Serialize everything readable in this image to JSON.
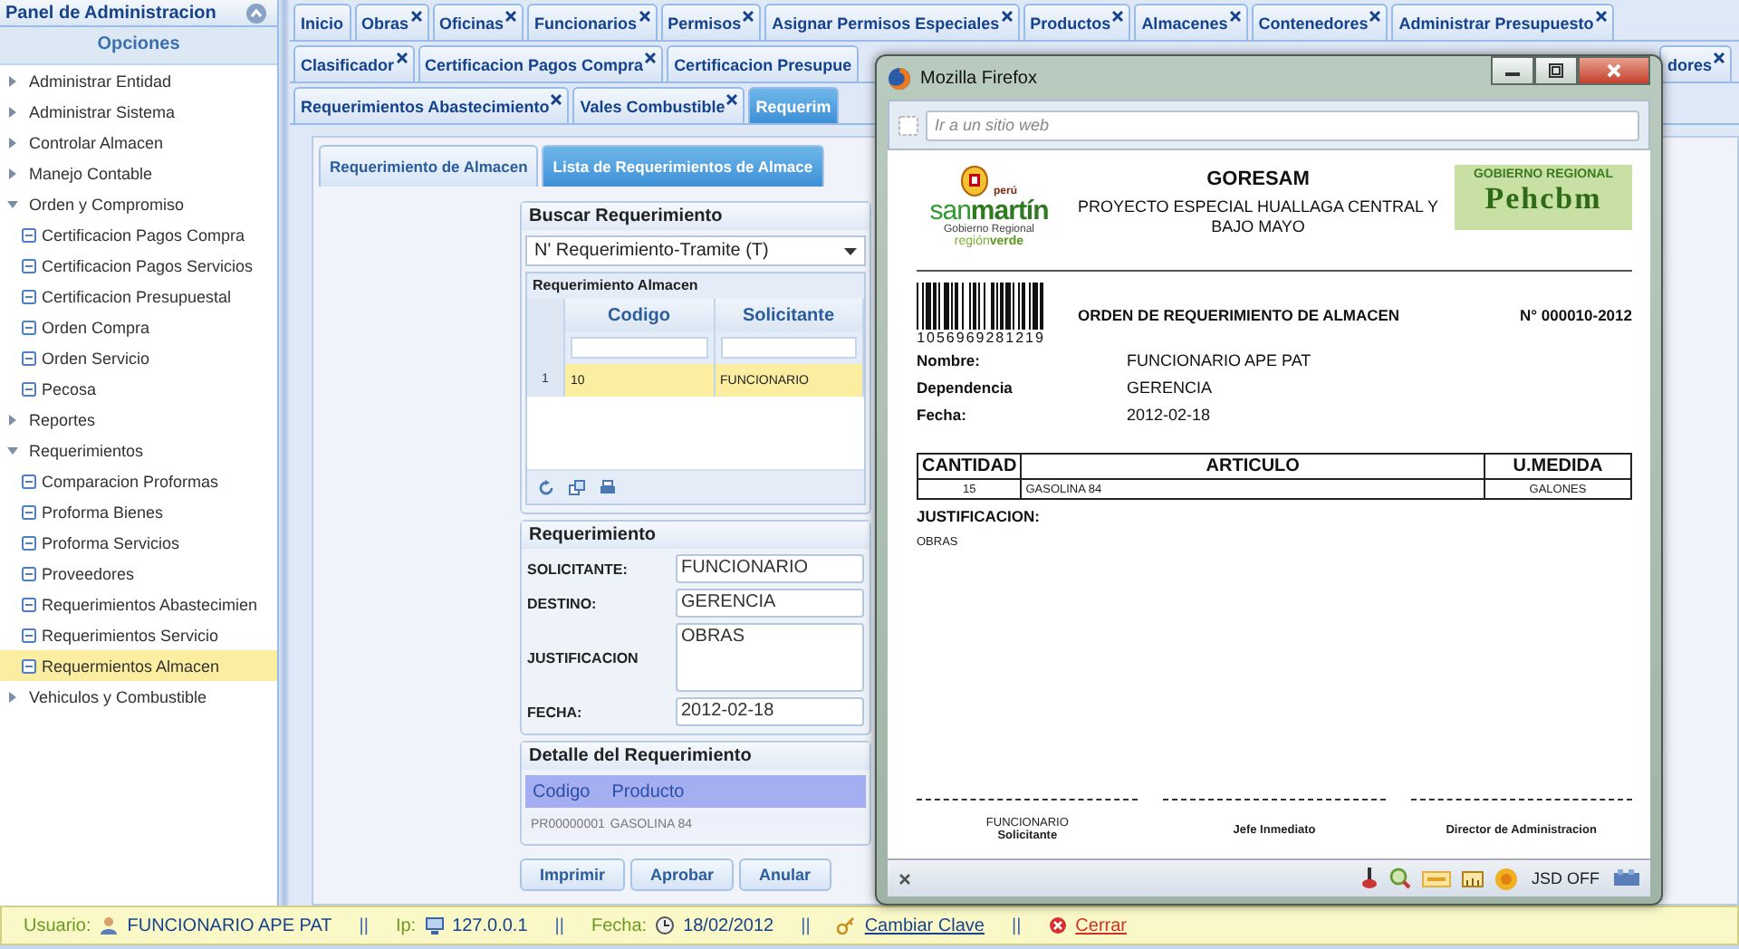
{
  "sidebar": {
    "title": "Panel de Administracion",
    "subtitle": "Opciones",
    "items": [
      {
        "label": "Administrar Entidad",
        "expanded": false
      },
      {
        "label": "Administrar Sistema",
        "expanded": false
      },
      {
        "label": "Controlar Almacen",
        "expanded": false
      },
      {
        "label": "Manejo Contable",
        "expanded": false
      },
      {
        "label": "Orden y Compromiso",
        "expanded": true,
        "children": [
          {
            "label": "Certificacion Pagos Compra",
            "selected": false
          },
          {
            "label": "Certificacion Pagos Servicios",
            "selected": false
          },
          {
            "label": "Certificacion Presupuestal",
            "selected": false
          },
          {
            "label": "Orden Compra",
            "selected": false
          },
          {
            "label": "Orden Servicio",
            "selected": false
          },
          {
            "label": "Pecosa",
            "selected": false
          }
        ]
      },
      {
        "label": "Reportes",
        "expanded": false
      },
      {
        "label": "Requerimientos",
        "expanded": true,
        "children": [
          {
            "label": "Comparacion Proformas",
            "selected": false
          },
          {
            "label": "Proforma Bienes",
            "selected": false
          },
          {
            "label": "Proforma Servicios",
            "selected": false
          },
          {
            "label": "Proveedores",
            "selected": false
          },
          {
            "label": "Requerimientos Abastecimien",
            "selected": false
          },
          {
            "label": "Requerimientos Servicio",
            "selected": false
          },
          {
            "label": "Requermientos Almacen",
            "selected": true
          }
        ]
      },
      {
        "label": "Vehiculos y Combustible",
        "expanded": false
      }
    ]
  },
  "tab_rows": [
    {
      "tabs": [
        {
          "label": "Inicio",
          "closable": false,
          "selected": false
        },
        {
          "label": "Obras",
          "closable": true,
          "selected": false
        },
        {
          "label": "Oficinas",
          "closable": true,
          "selected": false
        },
        {
          "label": "Funcionarios",
          "closable": true,
          "selected": false
        },
        {
          "label": "Permisos",
          "closable": true,
          "selected": false
        },
        {
          "label": "Asignar Permisos Especiales",
          "closable": true,
          "selected": false
        },
        {
          "label": "Productos",
          "closable": true,
          "selected": false
        },
        {
          "label": "Almacenes",
          "closable": true,
          "selected": false
        },
        {
          "label": "Contenedores",
          "closable": true,
          "selected": false
        },
        {
          "label": "Administrar Presupuesto",
          "closable": true,
          "selected": false
        }
      ]
    },
    {
      "tabs": [
        {
          "label": "Clasificador",
          "closable": true,
          "selected": false
        },
        {
          "label": "Certificacion Pagos Compra",
          "closable": true,
          "selected": false
        },
        {
          "label": "Certificacion Presupue",
          "closable": false,
          "selected": false
        },
        {
          "label": "dores",
          "closable": true,
          "selected": false,
          "kind": "partial"
        }
      ]
    },
    {
      "tabs": [
        {
          "label": "Requerimientos Abastecimiento",
          "closable": true,
          "selected": false
        },
        {
          "label": "Vales Combustible",
          "closable": true,
          "selected": false
        },
        {
          "label": "Requerim",
          "closable": false,
          "selected": true
        }
      ]
    }
  ],
  "inner_tabs": [
    {
      "label": "Requerimiento de Almacen",
      "selected": false
    },
    {
      "label": "Lista de Requerimientos de Almace",
      "selected": true
    }
  ],
  "search": {
    "title": "Buscar Requerimiento",
    "select": "N' Requerimiento-Tramite (T)",
    "grid": {
      "title": "Requerimiento Almacen",
      "columns": [
        "Codigo",
        "Solicitante"
      ],
      "rows": [
        {
          "number": "1",
          "cells": [
            "10",
            "FUNCIONARIO"
          ],
          "selected": true
        }
      ]
    }
  },
  "requerimiento": {
    "title": "Requerimiento",
    "fields": [
      {
        "label": "SOLICITANTE:",
        "value": "FUNCIONARIO",
        "kind": "input"
      },
      {
        "label": "DESTINO:",
        "value": "GERENCIA",
        "kind": "input"
      },
      {
        "label": "JUSTIFICACION",
        "value": "OBRAS",
        "kind": "textarea"
      },
      {
        "label": "FECHA:",
        "value": "2012-02-18",
        "kind": "input"
      }
    ]
  },
  "detalle": {
    "title": "Detalle del Requerimiento",
    "columns": [
      "Codigo",
      "Producto"
    ],
    "rows": [
      [
        "PR00000001",
        "GASOLINA 84"
      ]
    ]
  },
  "buttons": [
    "Imprimir",
    "Aprobar",
    "Anular"
  ],
  "browser": {
    "title": "Mozilla Firefox",
    "address_placeholder": "Ir a un sitio web",
    "document": {
      "logo_left": {
        "country": "perú",
        "name": "san**martín**",
        "line": "Gobierno Regional",
        "slogan": "región**verde**"
      },
      "heading": "GORESAM",
      "subheading": "PROYECTO ESPECIAL HUALLAGA CENTRAL Y BAJO MAYO",
      "logo_right": {
        "top": "GOBIERNO REGIONAL",
        "name": "Pehcbm"
      },
      "barcode_number": "1056969281219",
      "title": "ORDEN DE REQUERIMIENTO DE ALMACEN",
      "number": "N° 000010-2012",
      "info": [
        {
          "label": "Nombre:",
          "value": "FUNCIONARIO APE PAT"
        },
        {
          "label": "Dependencia",
          "value": "GERENCIA"
        },
        {
          "label": "Fecha:",
          "value": "2012-02-18"
        }
      ],
      "table": {
        "columns": [
          "CANTIDAD",
          "ARTICULO",
          "U.MEDIDA"
        ],
        "rows": [
          [
            "15",
            "GASOLINA 84",
            "GALONES"
          ]
        ]
      },
      "justification_label": "JUSTIFICACION:",
      "justification": "OBRAS",
      "signatures": [
        {
          "name": "FUNCIONARIO",
          "role": "Solicitante"
        },
        {
          "role": "Jefe Inmediato"
        },
        {
          "role": "Director de Administracion"
        }
      ]
    },
    "addon_bar": {
      "status": "JSD OFF"
    }
  },
  "status_bar": [
    {
      "kind": "user",
      "label": "Usuario:",
      "value": "FUNCIONARIO APE PAT"
    },
    {
      "kind": "separator",
      "value": "||"
    },
    {
      "kind": "ip",
      "label": "Ip:",
      "value": "127.0.0.1"
    },
    {
      "kind": "separator",
      "value": "||"
    },
    {
      "kind": "date",
      "label": "Fecha:",
      "value": "18/02/2012"
    },
    {
      "kind": "separator",
      "value": "||"
    },
    {
      "kind": "password",
      "value": "Cambiar Clave"
    },
    {
      "kind": "separator",
      "value": "||"
    },
    {
      "kind": "logout",
      "value": "Cerrar"
    }
  ]
}
